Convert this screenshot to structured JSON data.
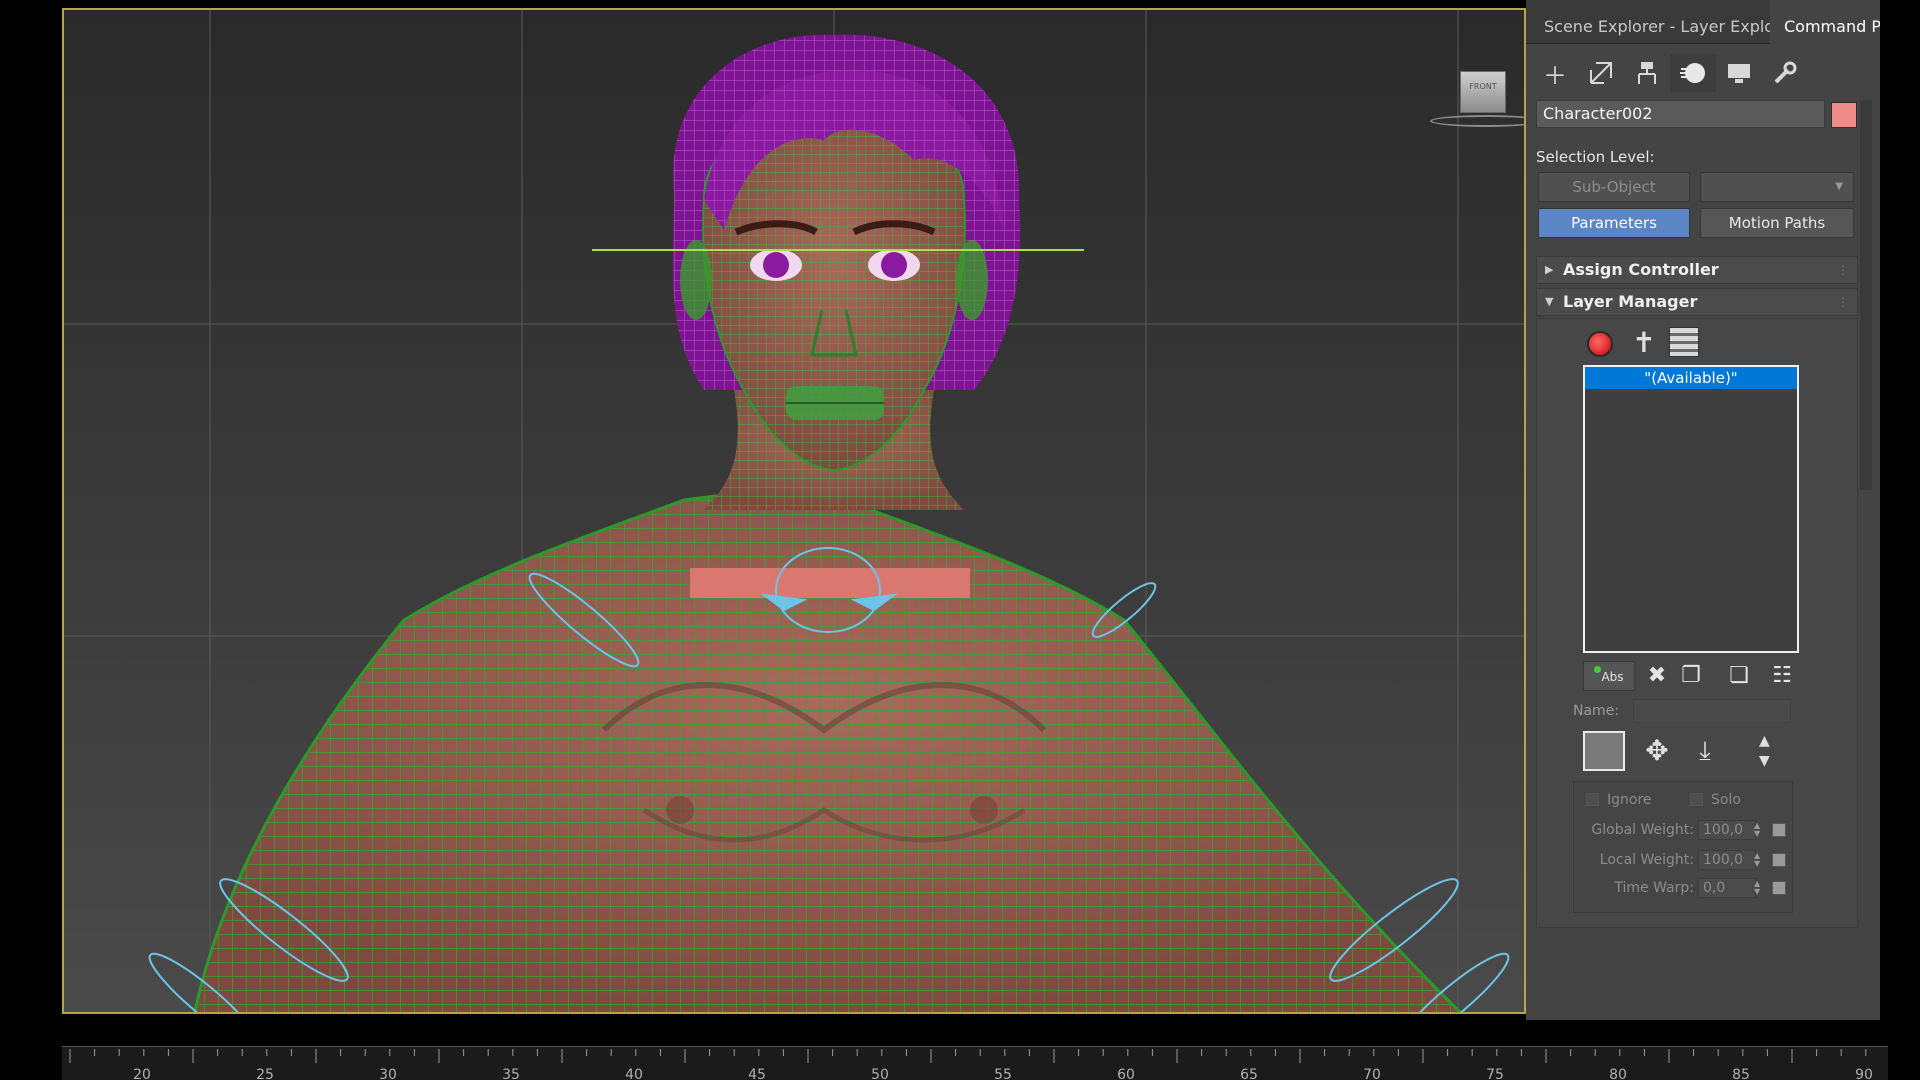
{
  "panel": {
    "tabs": [
      "Scene Explorer - Layer Explorer",
      "Command Par"
    ],
    "toolbar_icons": [
      "create-icon",
      "modify-icon",
      "hierarchy-icon",
      "motion-icon",
      "display-icon",
      "utilities-icon"
    ],
    "object_name": "Character002",
    "object_color": "#ef8c88",
    "selection_level_label": "Selection Level:",
    "sub_object_label": "Sub-Object",
    "parameters_label": "Parameters",
    "motion_paths_label": "Motion Paths",
    "assign_controller_label": "Assign Controller",
    "layer_manager_label": "Layer Manager",
    "layer_list": [
      "\"(Available)\""
    ],
    "abs_label": "Abs",
    "name_label": "Name:",
    "ignore_label": "Ignore",
    "solo_label": "Solo",
    "global_weight_label": "Global Weight:",
    "global_weight_value": "100,0",
    "local_weight_label": "Local Weight:",
    "local_weight_value": "100,0",
    "time_warp_label": "Time Warp:",
    "time_warp_value": "0,0"
  },
  "viewcube": {
    "face_label": "FRONT"
  },
  "timeline": {
    "ticks": [
      "20",
      "25",
      "30",
      "35",
      "40",
      "45",
      "50",
      "55",
      "60",
      "65",
      "70",
      "75",
      "80",
      "85",
      "90"
    ]
  },
  "colors": {
    "viewport_border": "#b6a44a",
    "selected_button": "#5b86c6",
    "selected_list_item": "#0078d7",
    "wireframe": "#2fa82f",
    "hair": "#8a1aa0"
  }
}
